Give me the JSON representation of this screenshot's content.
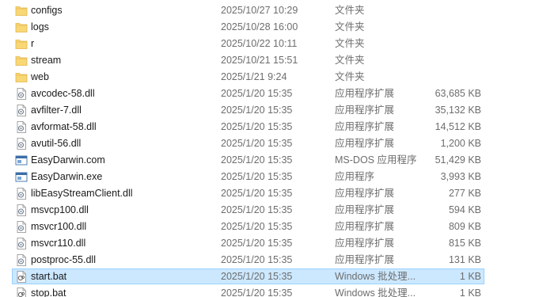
{
  "colors": {
    "folder": "#f8d775",
    "folder_edge": "#e3b54a",
    "selection_bg": "#cce8ff",
    "selection_border": "#99d1ff",
    "meta_text": "#6d6d6d"
  },
  "files": [
    {
      "name": "configs",
      "date": "2025/10/27 10:29",
      "type": "文件夹",
      "size": "",
      "icon": "folder-icon"
    },
    {
      "name": "logs",
      "date": "2025/10/28 16:00",
      "type": "文件夹",
      "size": "",
      "icon": "folder-icon"
    },
    {
      "name": "r",
      "date": "2025/10/22 10:11",
      "type": "文件夹",
      "size": "",
      "icon": "folder-icon"
    },
    {
      "name": "stream",
      "date": "2025/10/21 15:51",
      "type": "文件夹",
      "size": "",
      "icon": "folder-icon"
    },
    {
      "name": "web",
      "date": "2025/1/21 9:24",
      "type": "文件夹",
      "size": "",
      "icon": "folder-icon"
    },
    {
      "name": "avcodec-58.dll",
      "date": "2025/1/20 15:35",
      "type": "应用程序扩展",
      "size": "63,685 KB",
      "icon": "dll-icon"
    },
    {
      "name": "avfilter-7.dll",
      "date": "2025/1/20 15:35",
      "type": "应用程序扩展",
      "size": "35,132 KB",
      "icon": "dll-icon"
    },
    {
      "name": "avformat-58.dll",
      "date": "2025/1/20 15:35",
      "type": "应用程序扩展",
      "size": "14,512 KB",
      "icon": "dll-icon"
    },
    {
      "name": "avutil-56.dll",
      "date": "2025/1/20 15:35",
      "type": "应用程序扩展",
      "size": "1,200 KB",
      "icon": "dll-icon"
    },
    {
      "name": "EasyDarwin.com",
      "date": "2025/1/20 15:35",
      "type": "MS-DOS 应用程序",
      "size": "51,429 KB",
      "icon": "exe-icon"
    },
    {
      "name": "EasyDarwin.exe",
      "date": "2025/1/20 15:35",
      "type": "应用程序",
      "size": "3,993 KB",
      "icon": "exe-icon"
    },
    {
      "name": "libEasyStreamClient.dll",
      "date": "2025/1/20 15:35",
      "type": "应用程序扩展",
      "size": "277 KB",
      "icon": "dll-icon"
    },
    {
      "name": "msvcp100.dll",
      "date": "2025/1/20 15:35",
      "type": "应用程序扩展",
      "size": "594 KB",
      "icon": "dll-icon"
    },
    {
      "name": "msvcr100.dll",
      "date": "2025/1/20 15:35",
      "type": "应用程序扩展",
      "size": "809 KB",
      "icon": "dll-icon"
    },
    {
      "name": "msvcr110.dll",
      "date": "2025/1/20 15:35",
      "type": "应用程序扩展",
      "size": "815 KB",
      "icon": "dll-icon"
    },
    {
      "name": "postproc-55.dll",
      "date": "2025/1/20 15:35",
      "type": "应用程序扩展",
      "size": "131 KB",
      "icon": "dll-icon"
    },
    {
      "name": "start.bat",
      "date": "2025/1/20 15:35",
      "type": "Windows 批处理...",
      "size": "1 KB",
      "icon": "bat-icon",
      "selected": true
    },
    {
      "name": "stop.bat",
      "date": "2025/1/20 15:35",
      "type": "Windows 批处理...",
      "size": "1 KB",
      "icon": "bat-icon"
    }
  ]
}
